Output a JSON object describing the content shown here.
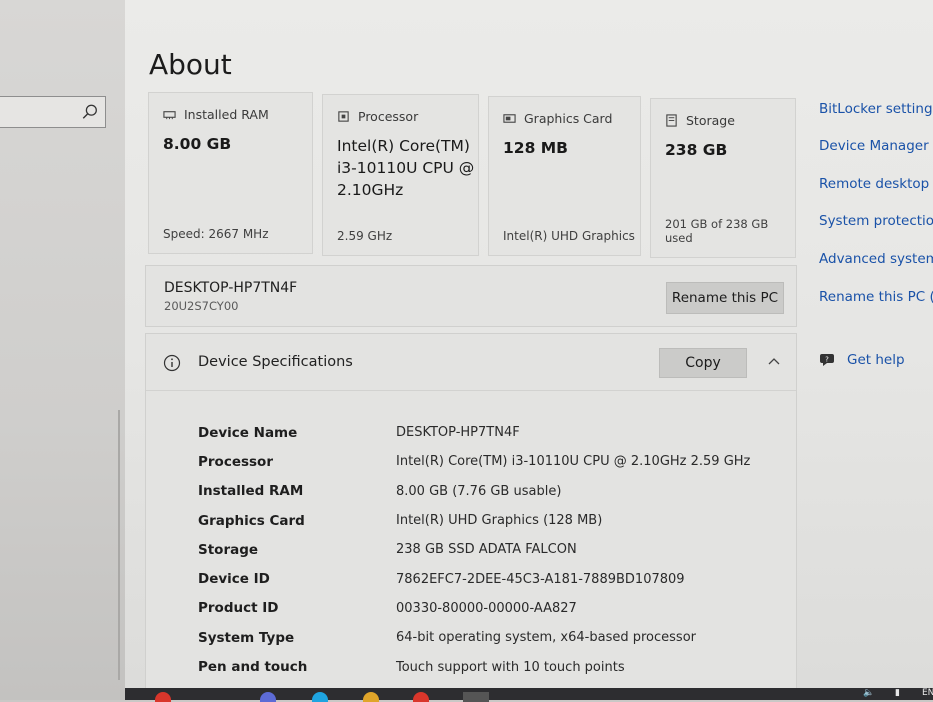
{
  "page": {
    "title": "About"
  },
  "search": {
    "placeholder": ""
  },
  "cards": [
    {
      "label": "Installed RAM",
      "icon": "ram-icon",
      "value": "8.00 GB",
      "sub": "Speed: 2667 MHz"
    },
    {
      "label": "Processor",
      "icon": "processor-icon",
      "value": "Intel(R) Core(TM) i3-10110U CPU @ 2.10GHz",
      "sub": "2.59 GHz"
    },
    {
      "label": "Graphics Card",
      "icon": "graphics-card-icon",
      "value": "128 MB",
      "sub": "Intel(R) UHD Graphics"
    },
    {
      "label": "Storage",
      "icon": "storage-icon",
      "value": "238 GB",
      "sub": "201 GB of 238 GB used"
    }
  ],
  "pc": {
    "name": "DESKTOP-HP7TN4F",
    "model": "20U2S7CY00",
    "rename_label": "Rename this PC"
  },
  "specs": {
    "title": "Device Specifications",
    "copy_label": "Copy",
    "rows": [
      {
        "key": "Device Name",
        "value": "DESKTOP-HP7TN4F"
      },
      {
        "key": "Processor",
        "value": "Intel(R) Core(TM) i3-10110U CPU @ 2.10GHz   2.59 GHz"
      },
      {
        "key": "Installed RAM",
        "value": "8.00 GB (7.76 GB usable)"
      },
      {
        "key": "Graphics Card",
        "value": "Intel(R) UHD Graphics (128 MB)"
      },
      {
        "key": "Storage",
        "value": "238 GB SSD ADATA FALCON"
      },
      {
        "key": "Device ID",
        "value": "7862EFC7-2DEE-45C3-A181-7889BD107809"
      },
      {
        "key": "Product ID",
        "value": "00330-80000-00000-AA827"
      },
      {
        "key": "System Type",
        "value": "64-bit operating system, x64-based processor"
      },
      {
        "key": "Pen and touch",
        "value": "Touch support with 10 touch points"
      }
    ]
  },
  "related_links": [
    "BitLocker settings",
    "Device Manager",
    "Remote desktop",
    "System protection",
    "Advanced system se",
    "Rename this PC (ad"
  ],
  "help": {
    "label": "Get help"
  },
  "taskbar": {
    "lang": "EN"
  },
  "colors": {
    "link": "#1a52a8",
    "background": "#e8e8e6",
    "button": "#cbcbc9"
  }
}
